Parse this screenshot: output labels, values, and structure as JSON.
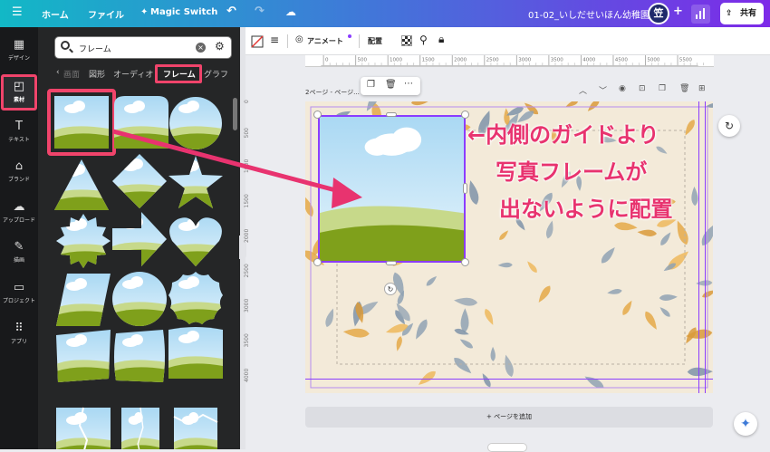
{
  "topbar": {
    "menu_icon": "hamburger-icon",
    "home": "ホーム",
    "file": "ファイル",
    "magic": "Magic Switch",
    "doc_title": "01-02_いしだせいほん幼稚園",
    "avatar": "笠",
    "share": "共有"
  },
  "rail": [
    {
      "icon": "design-icon",
      "label": "デザイン"
    },
    {
      "icon": "elements-icon",
      "label": "素材"
    },
    {
      "icon": "text-icon",
      "label": "テキスト"
    },
    {
      "icon": "brand-icon",
      "label": "ブランド"
    },
    {
      "icon": "upload-icon",
      "label": "アップロード"
    },
    {
      "icon": "draw-icon",
      "label": "描画"
    },
    {
      "icon": "projects-icon",
      "label": "プロジェクト"
    },
    {
      "icon": "apps-icon",
      "label": "アプリ"
    }
  ],
  "panel": {
    "search_value": "フレーム",
    "tabs": [
      "画面",
      "図形",
      "オーディオ",
      "フレーム",
      "グラフ"
    ]
  },
  "toolbar": {
    "animate": "アニメート",
    "position": "配置"
  },
  "ruler": {
    "h_ticks": [
      "0",
      "500",
      "1000",
      "1500",
      "2000",
      "2500",
      "3000",
      "3500",
      "4000",
      "4500",
      "5000",
      "5500"
    ],
    "v_ticks": [
      "0",
      "500",
      "1000",
      "1500",
      "2000",
      "2500",
      "3000",
      "3500",
      "4000"
    ]
  },
  "page": {
    "label": "2ページ - ページ..."
  },
  "callout": {
    "line1": "←内側のガイドより",
    "line2": "写真フレームが",
    "line3": "出ないように配置"
  },
  "add_page": "+ ページを追加",
  "colors": {
    "accent": "#e8336f",
    "selection": "#8b3dff",
    "sky": "#bfe3f7",
    "grass": "#8aab1e"
  }
}
